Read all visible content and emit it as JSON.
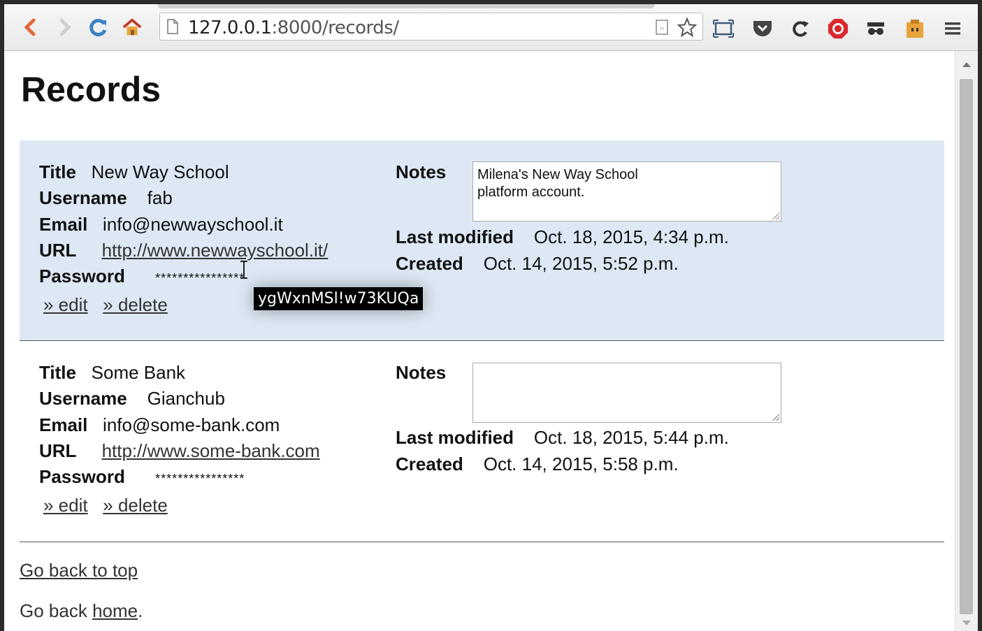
{
  "browser": {
    "url_host": "127.0.0.1",
    "url_rest": ":8000/records/"
  },
  "page": {
    "title": "Records"
  },
  "labels": {
    "title": "Title",
    "username": "Username",
    "email": "Email",
    "url": "URL",
    "password": "Password",
    "notes": "Notes",
    "last_modified": "Last modified",
    "created": "Created",
    "edit": "» edit",
    "delete": "» delete"
  },
  "records": [
    {
      "title": "New Way School",
      "username": "fab",
      "email": "info@newwayschool.it",
      "url": "http://www.newwayschool.it/",
      "password_masked": "****************",
      "notes": "Milena's New Way School\nplatform account.",
      "last_modified": "Oct. 18, 2015, 4:34 p.m.",
      "created": "Oct. 14, 2015, 5:52 p.m."
    },
    {
      "title": "Some Bank",
      "username": "Gianchub",
      "email": "info@some-bank.com",
      "url": "http://www.some-bank.com",
      "password_masked": "****************",
      "notes": "",
      "last_modified": "Oct. 18, 2015, 5:44 p.m.",
      "created": "Oct. 14, 2015, 5:58 p.m."
    }
  ],
  "tooltip": {
    "text": "ygWxnMSl!w73KUQa"
  },
  "footer": {
    "top_link": "Go back to top",
    "home_prefix": "Go back ",
    "home_link": "home",
    "home_suffix": "."
  },
  "colors": {
    "highlight_row": "#dde8f4",
    "back_arrow": "#e0693c",
    "reload": "#3b82c4",
    "pocket": "#444444",
    "adblock": "#d9282f"
  },
  "icons": [
    "back-icon",
    "forward-icon",
    "reload-icon",
    "home-icon",
    "page-icon",
    "reader-icon",
    "bookmark-star-icon",
    "fullscreen-icon",
    "pocket-icon",
    "refresh-ext-icon",
    "adblock-icon",
    "incognito-icon",
    "extension-icon",
    "menu-icon"
  ]
}
